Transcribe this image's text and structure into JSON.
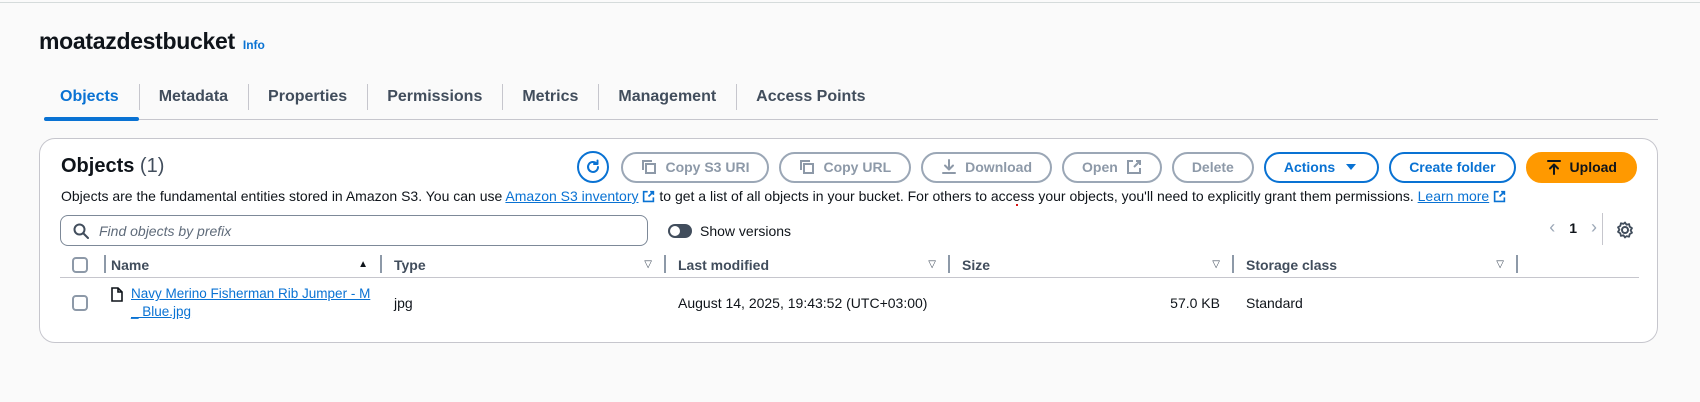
{
  "bucket": {
    "name": "moatazdestbucket",
    "info_label": "Info"
  },
  "tabs": [
    {
      "label": "Objects",
      "active": true
    },
    {
      "label": "Metadata"
    },
    {
      "label": "Properties"
    },
    {
      "label": "Permissions"
    },
    {
      "label": "Metrics"
    },
    {
      "label": "Management"
    },
    {
      "label": "Access Points"
    }
  ],
  "panel": {
    "title": "Objects",
    "count": "(1)",
    "description_part1": "Objects are the fundamental entities stored in Amazon S3. You can use ",
    "description_link1": "Amazon S3 inventory",
    "description_part2": " to get a list of all objects in your bucket. For others to access your objects, you'll need to explicitly grant them permissions. ",
    "description_link2": "Learn more"
  },
  "toolbar": {
    "copy_s3_uri": "Copy S3 URI",
    "copy_url": "Copy URL",
    "download": "Download",
    "open": "Open",
    "delete": "Delete",
    "actions": "Actions",
    "create_folder": "Create folder",
    "upload": "Upload"
  },
  "search": {
    "placeholder": "Find objects by prefix"
  },
  "show_versions": {
    "label": "Show versions",
    "enabled": false
  },
  "pagination": {
    "current_page": "1"
  },
  "table": {
    "headers": [
      "Name",
      "Type",
      "Last modified",
      "Size",
      "Storage class"
    ],
    "rows": [
      {
        "name": "Navy Merino Fisherman Rib Jumper - M _ Blue.jpg",
        "type": "jpg",
        "last_modified": "August 14, 2025, 19:43:52 (UTC+03:00)",
        "size": "57.0 KB",
        "storage_class": "Standard"
      }
    ]
  },
  "colors": {
    "accent": "#0972d3",
    "upload": "#ff9900",
    "disabled": "#8d99a8"
  }
}
